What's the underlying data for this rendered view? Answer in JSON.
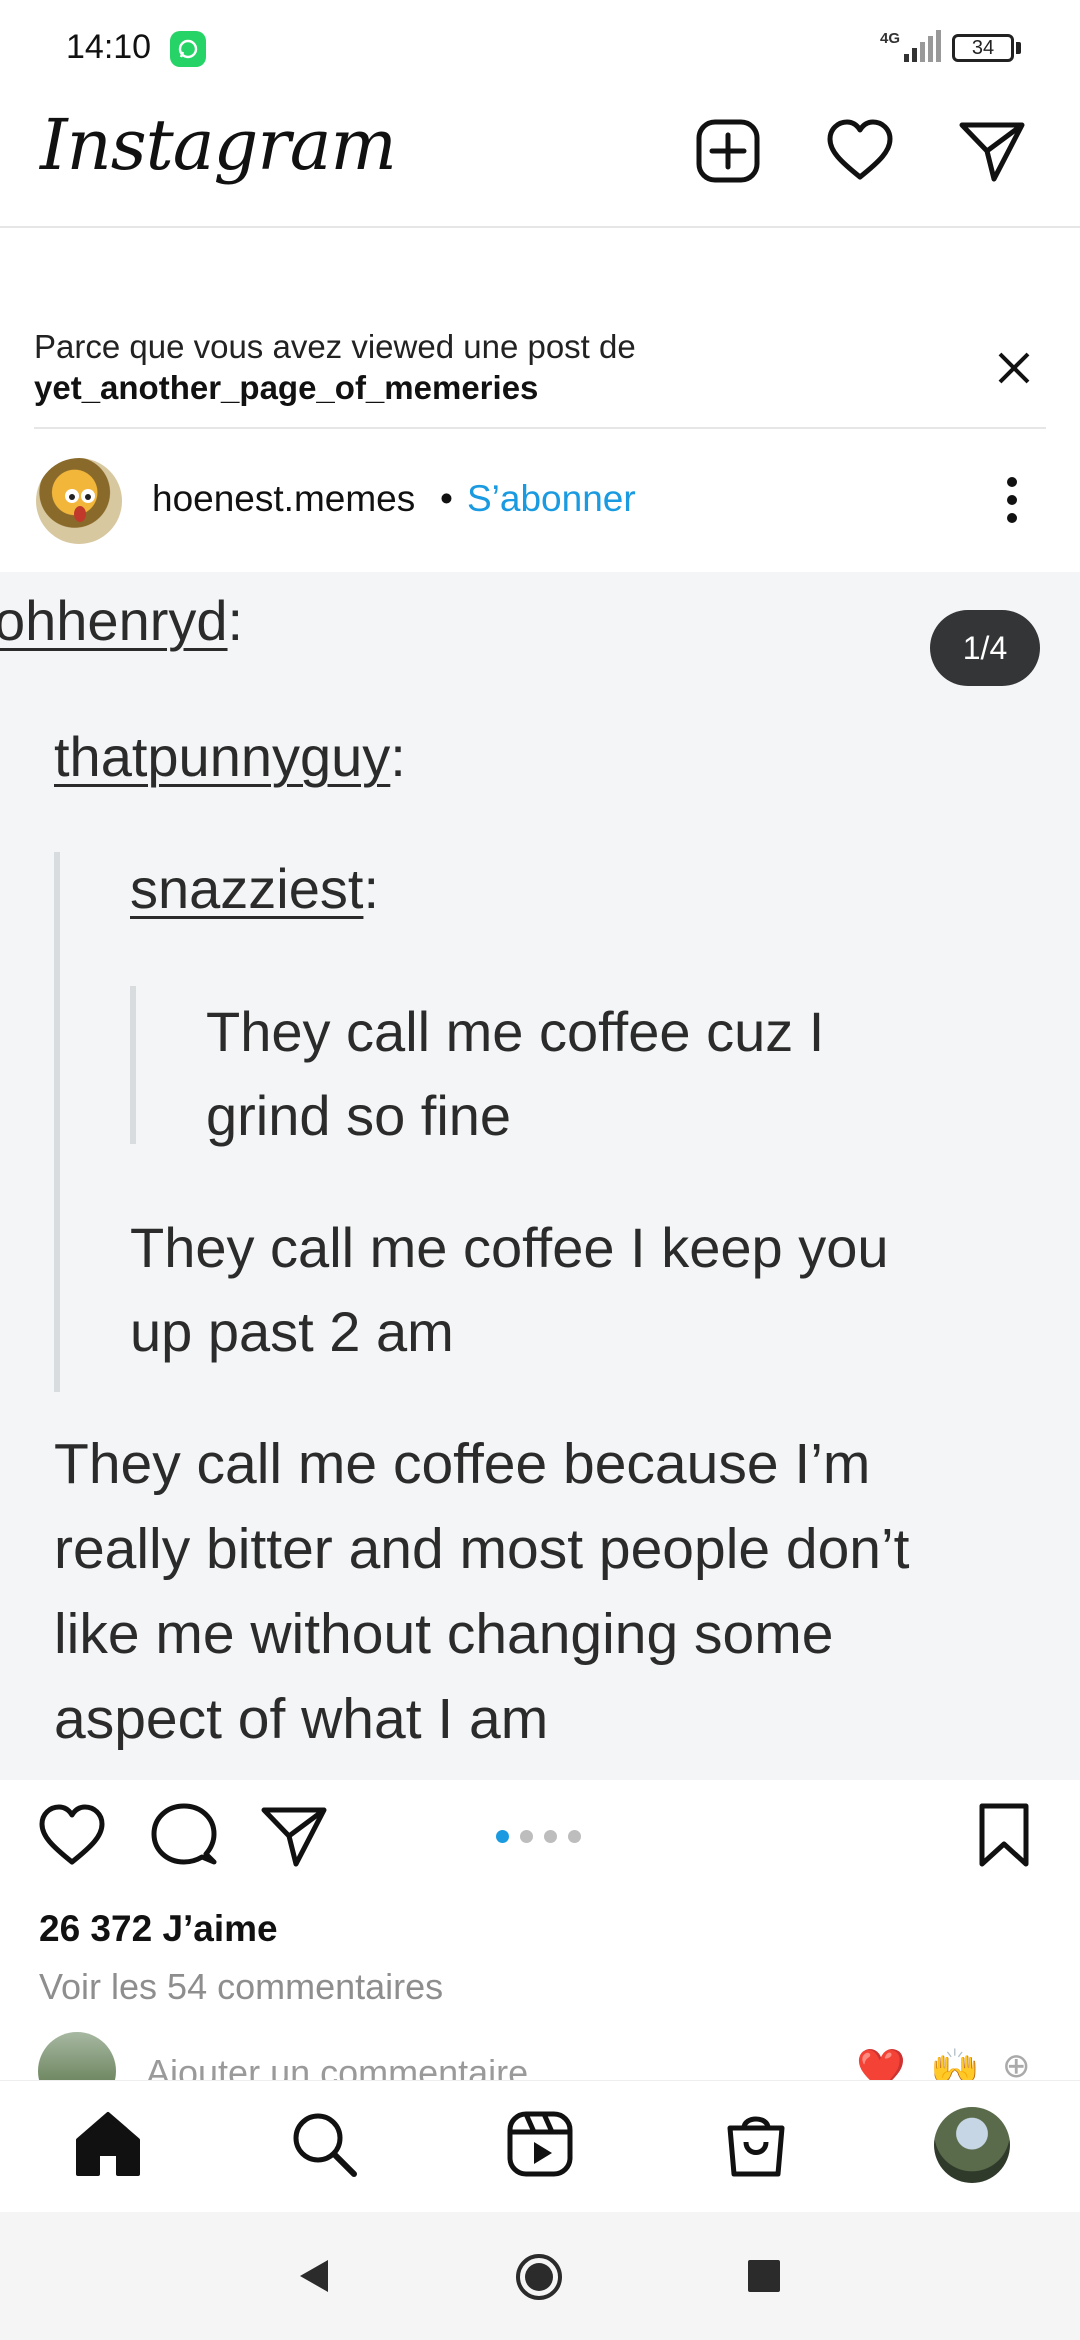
{
  "status_bar": {
    "time": "14:10",
    "network": "4G",
    "battery": "34"
  },
  "header": {
    "logo": "Instagram",
    "icons": [
      "new-post-icon",
      "heart-icon",
      "direct-message-icon"
    ]
  },
  "suggestion": {
    "reason_text": "Parce que vous avez viewed une post de",
    "source_account": "yet_another_page_of_memeries"
  },
  "post": {
    "username": "hoenest.memes",
    "separator": "•",
    "follow_label": "S’abonner",
    "counter": "1/4",
    "image_text": {
      "user1": "ohhenryd",
      "user2": "thatpunnyguy",
      "user3": "snazziest",
      "quote1_line1": "They call me coffee cuz I",
      "quote1_line2": "grind so fine",
      "reply1_line1": "They call me coffee I keep you",
      "reply1_line2": "up past 2 am",
      "reply2_line1": "They call me coffee because I’m",
      "reply2_line2": "really bitter and most people don’t",
      "reply2_line3": "like me without changing some",
      "reply2_line4": "aspect of what I am",
      "colon": ":"
    },
    "carousel": {
      "total": 4,
      "active_index": 0
    },
    "likes": "26 372 J’aime",
    "comments_link": "Voir les 54 commentaires",
    "comment_placeholder": "Ajouter un commentaire",
    "quick_reactions": [
      "❤️",
      "🙌",
      "⊕"
    ]
  },
  "bottom_nav": {
    "items": [
      "home-icon",
      "search-icon",
      "reels-icon",
      "shop-icon",
      "profile-avatar"
    ]
  },
  "colors": {
    "accent": "#1a9ae0",
    "text": "#111111",
    "muted": "#8e8e8e"
  }
}
